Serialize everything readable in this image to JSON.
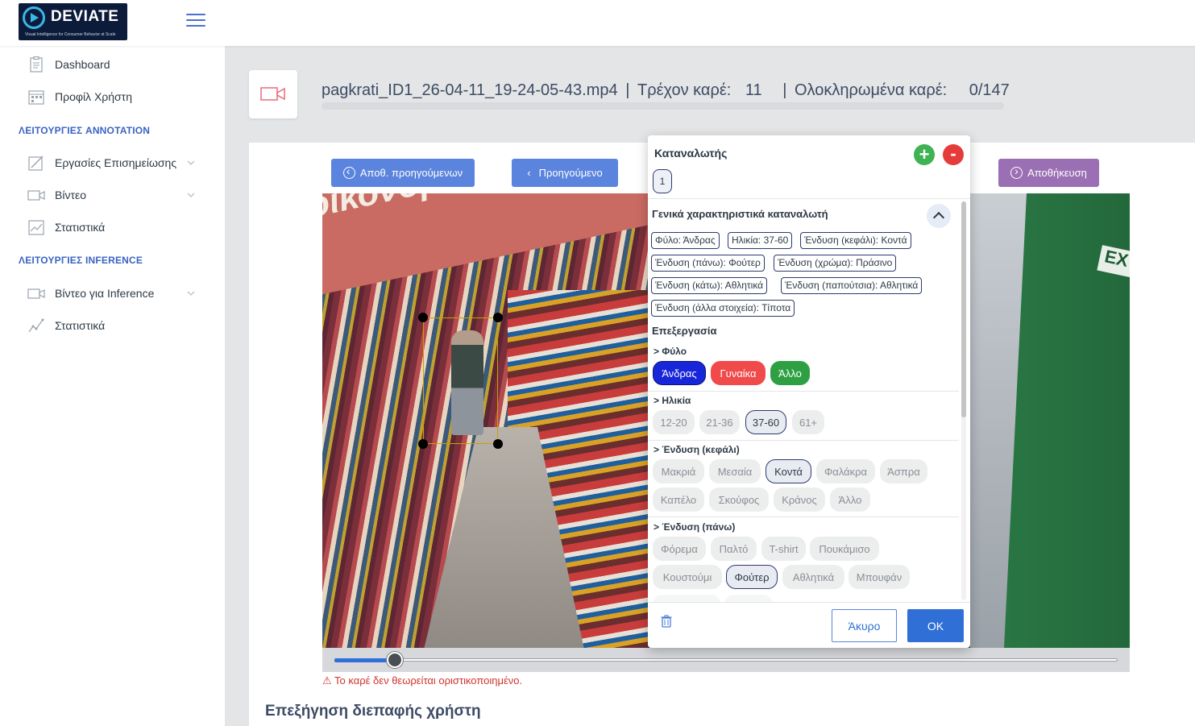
{
  "app": {
    "logo_text": "DEVIATE",
    "logo_subtitle": "Visual Intelligence for Consumer Behavior at Scale"
  },
  "sidebar": {
    "items_top": [
      {
        "label": "Dashboard",
        "icon": "clipboard-icon"
      },
      {
        "label": "Προφίλ Χρήστη",
        "icon": "calendar-icon"
      }
    ],
    "section_annotation": "ΛΕΙΤΟΥΡΓΙΕΣ ANNOTATION",
    "items_annotation": [
      {
        "label": "Εργασίες Επισημείωσης",
        "icon": "edit-icon",
        "expandable": true
      },
      {
        "label": "Βίντεο",
        "icon": "video-icon",
        "expandable": true
      },
      {
        "label": "Στατιστικά",
        "icon": "chart-icon",
        "expandable": false
      }
    ],
    "section_inference": "ΛΕΙΤΟΥΡΓΙΕΣ INFERENCE",
    "items_inference": [
      {
        "label": "Βίντεο για Inference",
        "icon": "video-icon",
        "expandable": true
      },
      {
        "label": "Στατιστικά",
        "icon": "line-chart-icon",
        "expandable": false
      }
    ]
  },
  "header": {
    "filename": "pagkrati_ID1_26-04-11_19-24-05-43.mp4",
    "sep1": "|",
    "current_frame_label": "Τρέχον καρέ:",
    "current_frame": "11",
    "sep2": "|",
    "completed_label": "Ολοκληρωμένα καρέ:",
    "completed": "0/147",
    "progress": 0.0
  },
  "toolbar": {
    "prev_done_label": "Αποθ. προηγούμενων",
    "prev_label": "Προηγούμενο",
    "save_label": "Αποθήκευση"
  },
  "frame": {
    "banner_text": "οικονομικές αγορές.",
    "exit_sign": "EX",
    "slider_position": 0.077
  },
  "warning": "⚠ Το καρέ δεν θεωρείται οριστικοποιημένο.",
  "explain_title": "Επεξήγηση διεπαφής χρήστη",
  "modal": {
    "title": "Καταναλωτής",
    "add_symbol": "+",
    "remove_symbol": "-",
    "consumer_id": "1",
    "general_title": "Γενικά χαρακτηριστικά καταναλωτή",
    "tags": [
      "Φύλο: Άνδρας",
      "Ηλικία: 37-60",
      "Ένδυση (κεφάλι): Κοντά",
      "Ένδυση (πάνω): Φούτερ",
      "Ένδυση (χρώμα): Πράσινο",
      "Ένδυση (κάτω): Αθλητικά",
      "Ένδυση (παπούτσια): Αθλητικά",
      "Ένδυση (άλλα στοιχεία): Τίποτα"
    ],
    "edit_title": "Επεξεργασία",
    "gender": {
      "label": "> Φύλο",
      "options": [
        "Άνδρας",
        "Γυναίκα",
        "Άλλο"
      ],
      "selected": "Άνδρας"
    },
    "age": {
      "label": "> Ηλικία",
      "options": [
        "12-20",
        "21-36",
        "37-60",
        "61+"
      ],
      "selected": "37-60"
    },
    "head": {
      "label": "> Ένδυση (κεφάλι)",
      "options": [
        "Μακριά",
        "Μεσαία",
        "Κοντά",
        "Φαλάκρα",
        "Άσπρα",
        "Καπέλο",
        "Σκούφος",
        "Κράνος",
        "Άλλο"
      ],
      "selected": "Κοντά"
    },
    "top": {
      "label": "> Ένδυση (πάνω)",
      "options": [
        "Φόρεμα",
        "Παλτό",
        "T-shirt",
        "Πουκάμισο",
        "Κουστούμι",
        "Φούτερ",
        "Αθλητικά",
        "Μπουφάν"
      ],
      "selected": "Φούτερ"
    },
    "cancel_label": "Άκυρο",
    "ok_label": "OK"
  }
}
